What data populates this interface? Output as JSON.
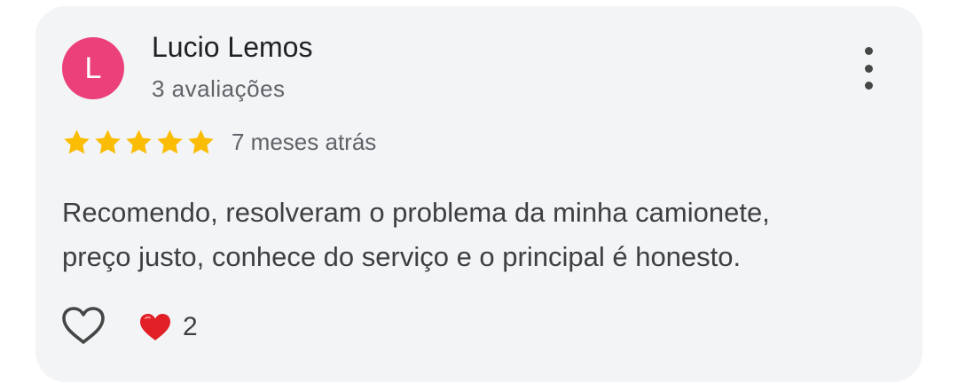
{
  "reviewer": {
    "initial": "L",
    "name": "Lucio Lemos",
    "review_count": "3 avaliações",
    "avatar_color": "#ec407a"
  },
  "rating": {
    "stars": 5,
    "max_stars": 5,
    "star_color": "#fbbc04",
    "date": "7 meses atrás"
  },
  "review": {
    "lines": [
      "Recomendo, resolveram o problema da minha camionete,",
      "preço justo, conhece do serviço e o principal é honesto."
    ]
  },
  "reactions": {
    "like_icon": "heart-outline-icon",
    "reaction_icon": "red-heart-emoji",
    "count": "2"
  },
  "menu": {
    "icon": "more-vert-icon"
  }
}
